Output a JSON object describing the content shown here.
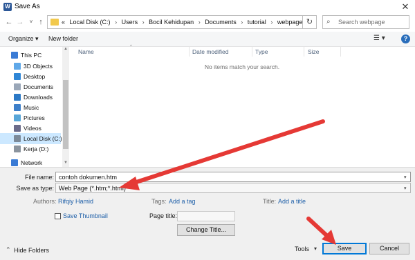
{
  "window": {
    "title": "Save As",
    "app_icon_letter": "W",
    "close_glyph": "✕"
  },
  "navigation": {
    "back_glyph": "←",
    "forward_glyph": "→",
    "recent_glyph": "˅",
    "up_glyph": "↑",
    "breadcrumb": [
      "«",
      "Local Disk (C:)",
      "Users",
      "Bocil Kehidupan",
      "Documents",
      "tutorial",
      "webpage"
    ],
    "separator": "›",
    "refresh_glyph": "↻",
    "search_placeholder": "Search webpage"
  },
  "toolbar": {
    "organize_label": "Organize ▾",
    "new_folder_label": "New folder",
    "view_glyph": "☰ ▾",
    "help_glyph": "?"
  },
  "sidebar": {
    "items": [
      {
        "label": "This PC",
        "icon": "pc-icon",
        "color": "#3a7bd5"
      },
      {
        "label": "3D Objects",
        "icon": "3d-objects-icon",
        "color": "#5fa8e8"
      },
      {
        "label": "Desktop",
        "icon": "desktop-icon",
        "color": "#2f86d6"
      },
      {
        "label": "Documents",
        "icon": "documents-icon",
        "color": "#9aa7b8"
      },
      {
        "label": "Downloads",
        "icon": "downloads-icon",
        "color": "#2b78c5"
      },
      {
        "label": "Music",
        "icon": "music-icon",
        "color": "#3d7fc9"
      },
      {
        "label": "Pictures",
        "icon": "pictures-icon",
        "color": "#58a6d8"
      },
      {
        "label": "Videos",
        "icon": "videos-icon",
        "color": "#6b6b8a"
      },
      {
        "label": "Local Disk (C:)",
        "icon": "local-disk-icon",
        "color": "#7c8a99",
        "selected": true
      },
      {
        "label": "Kerja (D:)",
        "icon": "drive-icon",
        "color": "#8b949e"
      },
      {
        "label": "Network",
        "icon": "network-icon",
        "color": "#3a7bd5"
      }
    ]
  },
  "file_list": {
    "columns": [
      "Name",
      "Date modified",
      "Type",
      "Size"
    ],
    "sort_glyph": "^",
    "empty_message": "No items match your search."
  },
  "form": {
    "file_name_label": "File name:",
    "file_name_value": "contoh dokumen.htm",
    "save_as_type_label": "Save as type:",
    "save_as_type_value": "Web Page (*.htm;*.html)",
    "authors_label": "Authors:",
    "authors_value": "Rifqiy Hamid",
    "tags_label": "Tags:",
    "tags_value": "Add a tag",
    "title_label": "Title:",
    "title_value": "Add a title",
    "save_thumbnail_label": "Save Thumbnail",
    "page_title_label": "Page title:",
    "change_title_label": "Change Title..."
  },
  "footer": {
    "hide_folders_label": "Hide Folders",
    "hide_folders_glyph": "⌃",
    "tools_label": "Tools",
    "tools_glyph": "▾",
    "save_label": "Save",
    "cancel_label": "Cancel"
  },
  "annotation_color": "#e53935"
}
